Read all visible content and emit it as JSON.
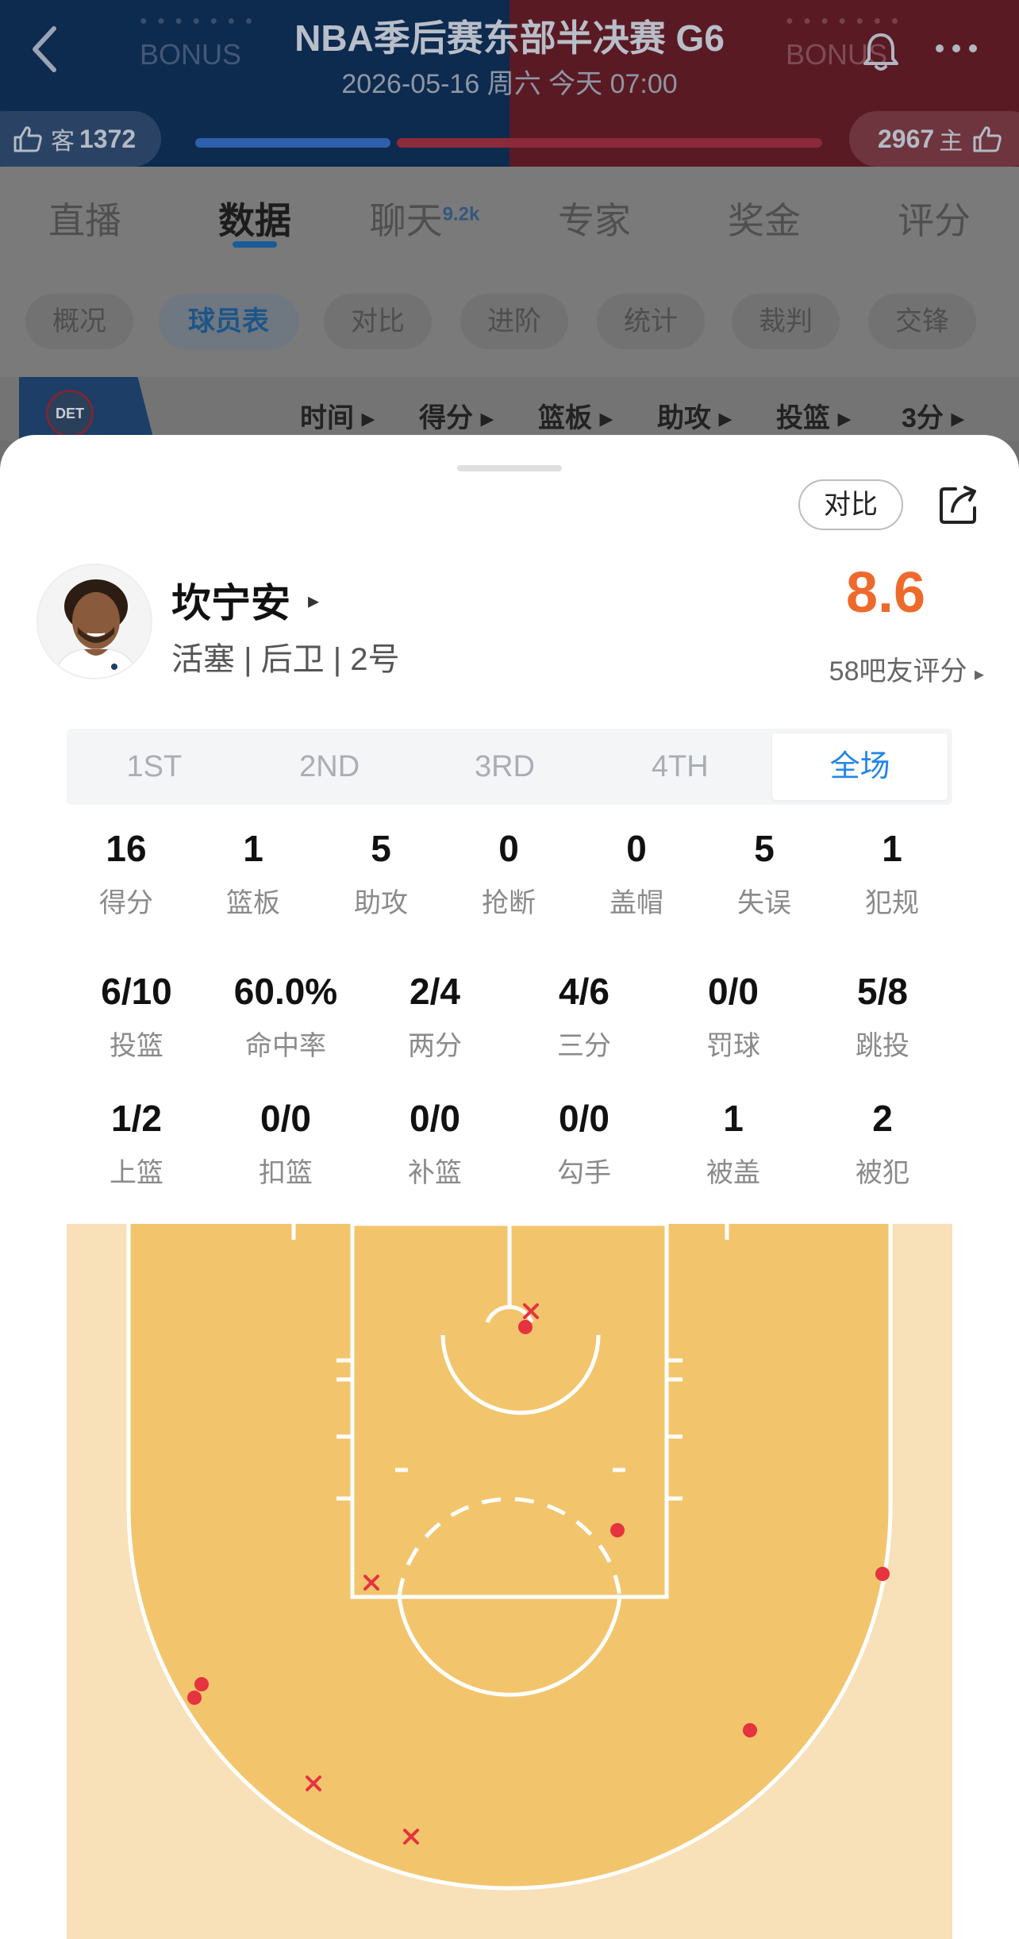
{
  "header": {
    "title": "NBA季后赛东部半决赛 G6",
    "subtitle": "2026-05-16 周六 今天 07:00",
    "bonus_left": "BONUS",
    "bonus_right": "BONUS",
    "away_label": "客",
    "away_likes": "1372",
    "home_label": "主",
    "home_likes": "2967",
    "colors": {
      "away": "#0d2a4f",
      "home": "#5a1a24"
    }
  },
  "nav": {
    "tabs": [
      {
        "label": "直播"
      },
      {
        "label": "数据",
        "active": true
      },
      {
        "label": "聊天",
        "badge": "9.2k"
      },
      {
        "label": "专家"
      },
      {
        "label": "奖金"
      },
      {
        "label": "评分"
      }
    ]
  },
  "subnav": {
    "chips": [
      {
        "label": "概况"
      },
      {
        "label": "球员表",
        "active": true
      },
      {
        "label": "对比"
      },
      {
        "label": "进阶"
      },
      {
        "label": "统计"
      },
      {
        "label": "裁判"
      },
      {
        "label": "交锋"
      }
    ]
  },
  "table_header": {
    "team_abbr": "DET",
    "columns": [
      "时间",
      "得分",
      "篮板",
      "助攻",
      "投篮",
      "3分"
    ]
  },
  "sheet": {
    "compare_label": "对比",
    "player": {
      "name": "坎宁安",
      "info": "活塞 | 后卫 | 2号",
      "rating": "8.6",
      "rating_count": "58吧友评分"
    },
    "periods": [
      {
        "label": "1ST"
      },
      {
        "label": "2ND"
      },
      {
        "label": "3RD"
      },
      {
        "label": "4TH"
      },
      {
        "label": "全场",
        "active": true
      }
    ],
    "stats_row1": [
      {
        "value": "16",
        "label": "得分"
      },
      {
        "value": "1",
        "label": "篮板"
      },
      {
        "value": "5",
        "label": "助攻"
      },
      {
        "value": "0",
        "label": "抢断"
      },
      {
        "value": "0",
        "label": "盖帽"
      },
      {
        "value": "5",
        "label": "失误"
      },
      {
        "value": "1",
        "label": "犯规"
      }
    ],
    "stats_row2": [
      {
        "value": "6/10",
        "label": "投篮"
      },
      {
        "value": "60.0%",
        "label": "命中率"
      },
      {
        "value": "2/4",
        "label": "两分"
      },
      {
        "value": "4/6",
        "label": "三分"
      },
      {
        "value": "0/0",
        "label": "罚球"
      },
      {
        "value": "5/8",
        "label": "跳投"
      }
    ],
    "stats_row3": [
      {
        "value": "1/2",
        "label": "上篮"
      },
      {
        "value": "0/0",
        "label": "扣篮"
      },
      {
        "value": "0/0",
        "label": "补篮"
      },
      {
        "value": "0/0",
        "label": "勾手"
      },
      {
        "value": "1",
        "label": "被盖"
      },
      {
        "value": "2",
        "label": "被犯"
      }
    ]
  }
}
